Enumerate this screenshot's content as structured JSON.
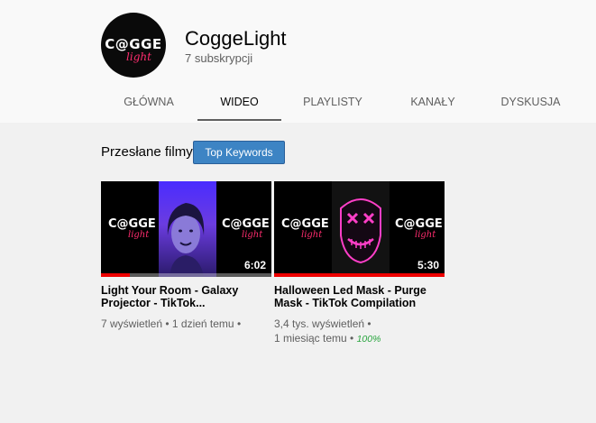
{
  "channel": {
    "name": "CoggeLight",
    "subscribers": "7 subskrypcji",
    "avatar_brand": "C@GGE",
    "avatar_sub": "light"
  },
  "tabs": [
    {
      "label": "GŁÓWNA",
      "active": false
    },
    {
      "label": "WIDEO",
      "active": true
    },
    {
      "label": "PLAYLISTY",
      "active": false
    },
    {
      "label": "KANAŁY",
      "active": false
    },
    {
      "label": "DYSKUSJA",
      "active": false
    }
  ],
  "section": {
    "title": "Przesłane filmy",
    "keywords_button": "Top Keywords"
  },
  "videos": [
    {
      "title_line1": "Light Your Room - Galaxy",
      "title_line2": "Projector - TikTok...",
      "meta_line1": "7 wyświetleń • 1 dzień temu •",
      "meta_line2": "",
      "percent": "",
      "duration": "6:02",
      "watched_fraction": 0.17
    },
    {
      "title_line1": "Halloween Led Mask - Purge",
      "title_line2": "Mask - TikTok Compilation",
      "meta_line1": "3,4 tys. wyświetleń •",
      "meta_line2": "1 miesiąc temu •",
      "percent": "100%",
      "duration": "5:30",
      "watched_fraction": 1.0
    }
  ],
  "thumb_brand": "C@GGE",
  "thumb_brand_sub": "light"
}
